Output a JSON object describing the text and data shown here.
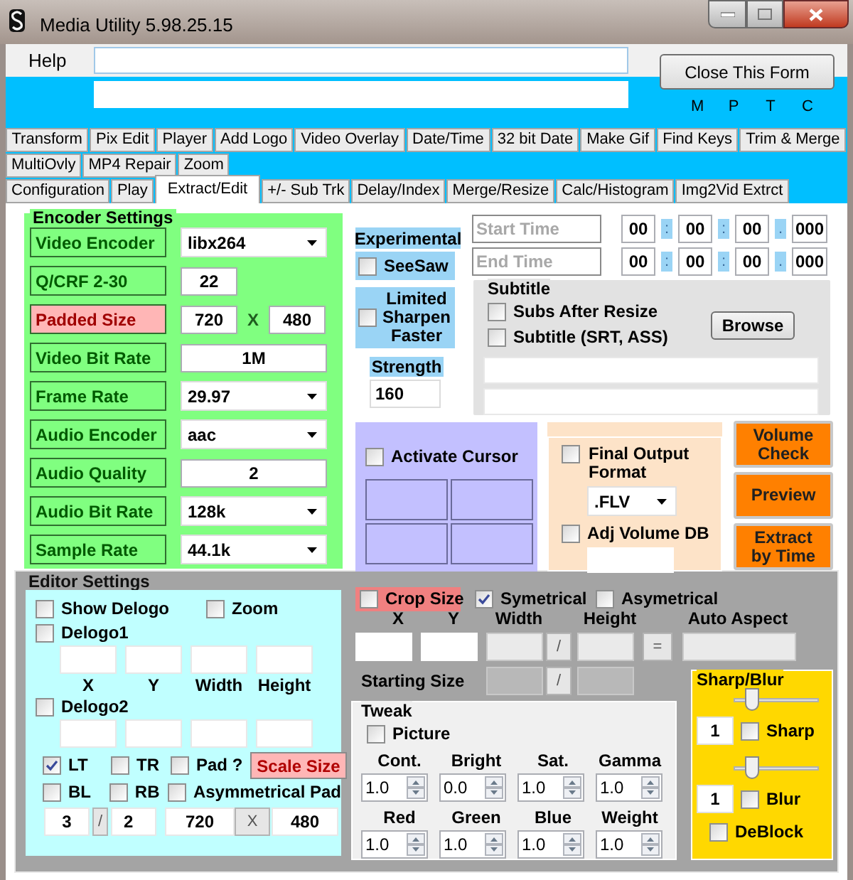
{
  "window": {
    "title": "Media Utility 5.98.25.15"
  },
  "help_bar": {
    "label": "Help",
    "close_button": "Close This Form",
    "indicators": [
      "M",
      "P",
      "T",
      "C"
    ]
  },
  "tab_rows": [
    [
      {
        "label": "Transform",
        "selected": false
      },
      {
        "label": "Pix Edit",
        "selected": false
      },
      {
        "label": "Player",
        "selected": false
      },
      {
        "label": "Add Logo",
        "selected": false
      },
      {
        "label": "Video Overlay",
        "selected": false
      },
      {
        "label": "Date/Time",
        "selected": false
      },
      {
        "label": "32 bit Date",
        "selected": false
      },
      {
        "label": "Make Gif",
        "selected": false
      },
      {
        "label": "Find Keys",
        "selected": false
      },
      {
        "label": "Trim & Merge",
        "selected": false
      }
    ],
    [
      {
        "label": "MultiOvly",
        "selected": false
      },
      {
        "label": "MP4 Repair",
        "selected": false
      },
      {
        "label": "Zoom",
        "selected": false
      }
    ],
    [
      {
        "label": "Configuration",
        "selected": false
      },
      {
        "label": "Play",
        "selected": false
      },
      {
        "label": "Extract/Edit",
        "selected": true
      },
      {
        "label": "+/- Sub Trk",
        "selected": false
      },
      {
        "label": "Delay/Index",
        "selected": false
      },
      {
        "label": "Merge/Resize",
        "selected": false
      },
      {
        "label": "Calc/Histogram",
        "selected": false
      },
      {
        "label": "Img2Vid Extrct",
        "selected": false
      }
    ]
  ],
  "encoder_settings": {
    "title": "Encoder Settings",
    "rows": [
      {
        "label": "Video Encoder",
        "kind": "dropdown",
        "value": "libx264",
        "highlighted": false
      },
      {
        "label": "Q/CRF  2-30",
        "kind": "small",
        "value": "22",
        "highlighted": false
      },
      {
        "label": "Padded Size",
        "kind": "pair",
        "values": [
          "720",
          "480"
        ],
        "separator": "X",
        "highlighted": true
      },
      {
        "label": "Video Bit Rate",
        "kind": "text",
        "value": "1M",
        "highlighted": false
      },
      {
        "label": "Frame Rate",
        "kind": "dropdown",
        "value": "29.97",
        "highlighted": false
      },
      {
        "label": "Audio Encoder",
        "kind": "dropdown",
        "value": "aac",
        "highlighted": false
      },
      {
        "label": "Audio Quality",
        "kind": "text",
        "value": "2",
        "highlighted": false
      },
      {
        "label": "Audio Bit Rate",
        "kind": "dropdown",
        "value": "128k",
        "highlighted": false
      },
      {
        "label": "Sample Rate",
        "kind": "dropdown",
        "value": "44.1k",
        "highlighted": false
      }
    ]
  },
  "experimental": {
    "title": "Experimental",
    "seesaw": {
      "label": "SeeSaw",
      "checked": false
    },
    "limited_sharpen": {
      "label": "Limited Sharpen Faster",
      "checked": false
    },
    "strength_label": "Strength",
    "strength": "160"
  },
  "time_rows": [
    {
      "placeholder": "Start Time",
      "fields": [
        "00",
        "00",
        "00",
        "000"
      ],
      "separators": [
        ":",
        ":",
        "."
      ]
    },
    {
      "placeholder": "End Time",
      "fields": [
        "00",
        "00",
        "00",
        "000"
      ],
      "separators": [
        ":",
        ":",
        "."
      ]
    }
  ],
  "subtitle": {
    "title": "Subtitle",
    "options": [
      {
        "label": "Subs After Resize",
        "checked": false
      },
      {
        "label": "Subtitle (SRT, ASS)",
        "checked": false
      }
    ],
    "browse_button": "Browse"
  },
  "cursor": {
    "label": "Activate Cursor",
    "checked": false
  },
  "output": {
    "final_format": {
      "label": "Final Output Format",
      "checked": false,
      "value": ".FLV"
    },
    "adj_volume": {
      "label": "Adj Volume DB",
      "checked": false
    }
  },
  "actions": [
    "Volume Check",
    "Preview",
    "Extract by Time"
  ],
  "editor_settings": {
    "title": "Editor Settings",
    "show_delogo": {
      "label": "Show Delogo",
      "checked": false
    },
    "zoom": {
      "label": "Zoom",
      "checked": false
    },
    "delogo1": {
      "label": "Delogo1",
      "checked": false
    },
    "coord_labels": [
      "X",
      "Y",
      "Width",
      "Height"
    ],
    "delogo2": {
      "label": "Delogo2",
      "checked": false
    },
    "corners": [
      {
        "label": "LT",
        "checked": true
      },
      {
        "label": "TR",
        "checked": false
      },
      {
        "label": "BL",
        "checked": false
      },
      {
        "label": "RB",
        "checked": false
      }
    ],
    "pad": {
      "label": "Pad ?",
      "checked": false
    },
    "scale_size": "Scale Size",
    "asym_pad": {
      "label": "Asymmetrical Pad",
      "checked": false
    },
    "ratio": [
      "3",
      "2"
    ],
    "ratio_separator": "/",
    "size": [
      "720",
      "480"
    ],
    "size_separator": "X"
  },
  "crop": {
    "crop_size": {
      "label": "Crop Size",
      "checked": false
    },
    "symetrical": {
      "label": "Symetrical",
      "checked": true
    },
    "asymetrical": {
      "label": "Asymetrical",
      "checked": false
    },
    "labels": [
      "X",
      "Y",
      "Width",
      "Height",
      "Auto Aspect"
    ],
    "slash": "/",
    "equals": "=",
    "starting_size": "Starting Size",
    "starting_slash": "/"
  },
  "tweak": {
    "title": "Tweak",
    "picture": {
      "label": "Picture",
      "checked": false
    },
    "spinners": [
      {
        "label": "Cont.",
        "value": "1.0"
      },
      {
        "label": "Bright",
        "value": "0.0"
      },
      {
        "label": "Sat.",
        "value": "1.0"
      },
      {
        "label": "Gamma",
        "value": "1.0"
      },
      {
        "label": "Red",
        "value": "1.0"
      },
      {
        "label": "Green",
        "value": "1.0"
      },
      {
        "label": "Blue",
        "value": "1.0"
      },
      {
        "label": "Weight",
        "value": "1.0"
      }
    ]
  },
  "sharp_blur": {
    "title": "Sharp/Blur",
    "sharp": {
      "level": 0.15,
      "value": "1",
      "label": "Sharp",
      "checked": false
    },
    "blur": {
      "level": 0.15,
      "value": "1",
      "label": "Blur",
      "checked": false
    },
    "deblock": {
      "label": "DeBlock",
      "checked": false
    }
  }
}
